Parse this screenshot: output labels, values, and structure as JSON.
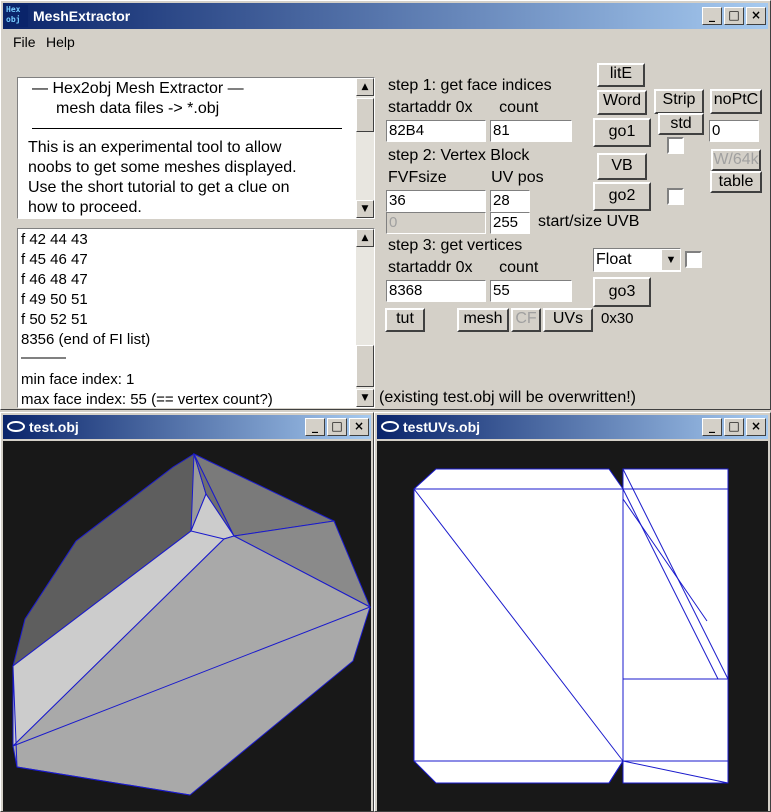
{
  "main_window": {
    "title": "MeshExtractor",
    "icon_text_top": "Hex",
    "icon_text_bottom": "obj",
    "menu": [
      "File",
      "Help"
    ],
    "controls": {
      "minimize": "_",
      "maximize": "□",
      "close": "×"
    }
  },
  "info_panel": {
    "lines": [
      "—  Hex2obj Mesh Extractor  —",
      "mesh data files -> *.obj",
      "————————————————",
      "This is an experimental tool to allow",
      "noobs to get some meshes displayed.",
      "Use the short tutorial to get a clue on",
      "how to proceed."
    ]
  },
  "log_panel": {
    "lines": [
      "f  42 44 43",
      "f  45 46 47",
      "f  46 48 47",
      "f  49 50 51",
      "f  50 52 51",
      "8356 (end of FI list)",
      "———",
      "min face index: 1",
      "max face index: 55 (== vertex count?)"
    ]
  },
  "step1": {
    "title": "step 1: get face indices",
    "sub": "startaddr 0x      count",
    "startaddr": "82B4",
    "count": "81"
  },
  "step2": {
    "title": "step 2: Vertex Block",
    "sub": "FVFsize          UV pos",
    "fvfsize": "36",
    "uvpos": "28",
    "uvb_start": "0",
    "uvb_size": "255",
    "uvb_label": "start/size UVB"
  },
  "step3": {
    "title": "step 3: get vertices",
    "sub": "startaddr 0x      count",
    "startaddr": "8368",
    "count": "55",
    "format": "Float",
    "format_arrow": "▼"
  },
  "buttons": {
    "lite": "litE",
    "word": "Word",
    "strip": "Strip",
    "noptc": "noPtC",
    "std": "std",
    "go1": "go1",
    "vb": "VB",
    "w64k": "W/64k",
    "table": "table",
    "go2": "go2",
    "go3": "go3",
    "tut": "tut",
    "mesh": "mesh",
    "cf": "CF",
    "uvs": "UVs",
    "hex": "0x30"
  },
  "right_field_value": "0",
  "status_text": "(existing test.obj will be overwritten!)",
  "view_test": {
    "title": "test.obj"
  },
  "view_uvs": {
    "title": "testUVs.obj"
  },
  "colors": {
    "titlebar": "#0a246a",
    "mesh_fill": "#a0a0a0",
    "mesh_edge": "#1a1acc",
    "viewport_bg": "#181818"
  }
}
